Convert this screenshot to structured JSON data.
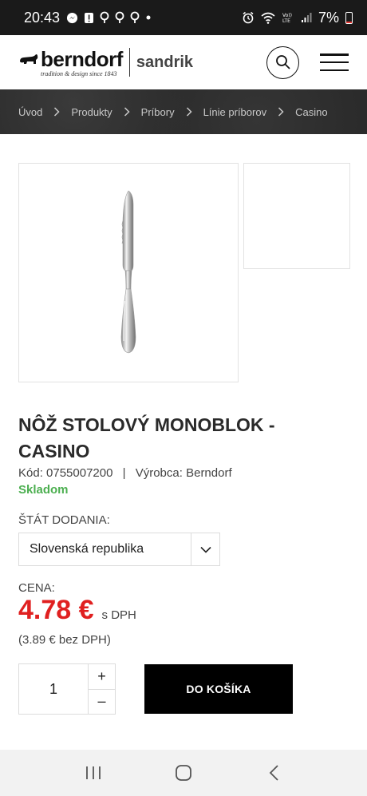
{
  "status_bar": {
    "time": "20:43",
    "battery": "7%",
    "icons": [
      "messenger-icon",
      "alert-icon",
      "location-icon",
      "location-icon",
      "location-icon",
      "dot-icon",
      "alarm-icon",
      "wifi-icon",
      "volte-icon",
      "signal-icon",
      "battery-icon"
    ],
    "volte_label": "Vo))\nLTE"
  },
  "header": {
    "brand_primary": "berndorf",
    "brand_tagline": "tradition & design since 1843",
    "brand_secondary": "sandrik",
    "search_icon": "search-icon",
    "menu_icon": "hamburger-menu-icon"
  },
  "breadcrumb": {
    "items": [
      "Úvod",
      "Produkty",
      "Príbory",
      "Línie príborov",
      "Casino"
    ]
  },
  "product": {
    "title": "NÔŽ STOLOVÝ MONOBLOK - CASINO",
    "code_label": "Kód:",
    "code_value": "0755007200",
    "manufacturer_label": "Výrobca:",
    "manufacturer_value": "Berndorf",
    "stock": "Skladom",
    "stock_color": "#4caf50"
  },
  "delivery": {
    "label": "ŠTÁT DODANIA:",
    "selected": "Slovenská republika"
  },
  "price": {
    "label": "CENA:",
    "value": "4.78 €",
    "vat_note": "s DPH",
    "net": "(3.89 € bez DPH)",
    "color": "#e02020"
  },
  "cart": {
    "quantity": "1",
    "plus": "+",
    "minus": "–",
    "button_label": "DO KOŠÍKA"
  },
  "nav_bar": {
    "icons": [
      "recent-apps-icon",
      "home-icon",
      "back-icon"
    ]
  }
}
